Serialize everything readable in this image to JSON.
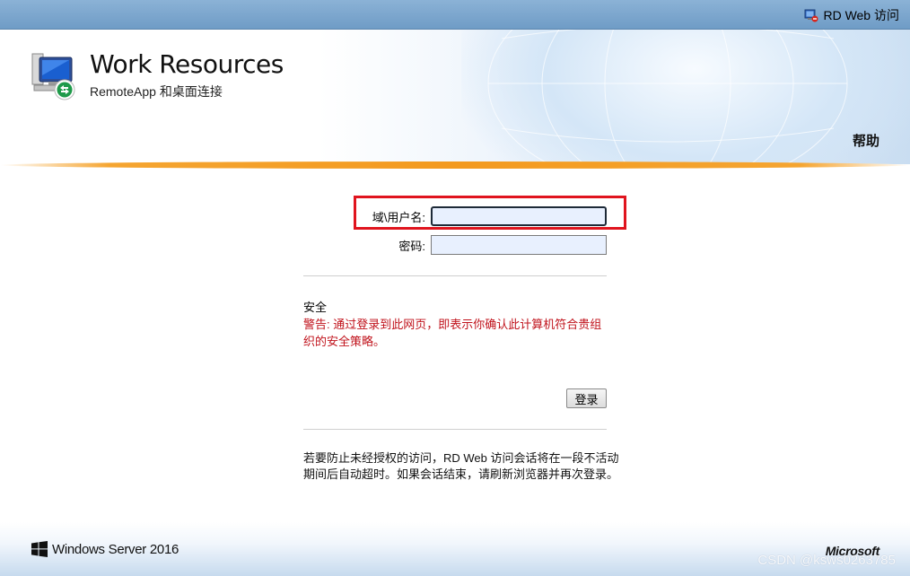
{
  "topbar": {
    "rd_web_link": "RD Web 访问",
    "icon": "rd-web-access-icon"
  },
  "header": {
    "title": "Work Resources",
    "subtitle": "RemoteApp 和桌面连接",
    "logo_icon": "remote-desktop-computer-icon",
    "help_label": "帮助"
  },
  "form": {
    "username_label": "域\\用户名:",
    "username_value": "",
    "password_label": "密码:",
    "password_value": "",
    "security_heading": "安全",
    "security_warning": "警告: 通过登录到此网页，即表示你确认此计算机符合贵组织的安全策略。",
    "login_button": "登录",
    "timeout_note": "若要防止未经授权的访问，RD Web 访问会话将在一段不活动期间后自动超时。如果会话结束，请刷新浏览器并再次登录。"
  },
  "footer": {
    "product": "Windows Server 2016",
    "vendor": "Microsoft",
    "watermark": "CSDN @ksws0263785"
  },
  "colors": {
    "highlight_border": "#e0141e",
    "warning_text": "#c0121b",
    "accent_orange": "#f39a1f",
    "topbar_blue": "#7ba7cf"
  }
}
